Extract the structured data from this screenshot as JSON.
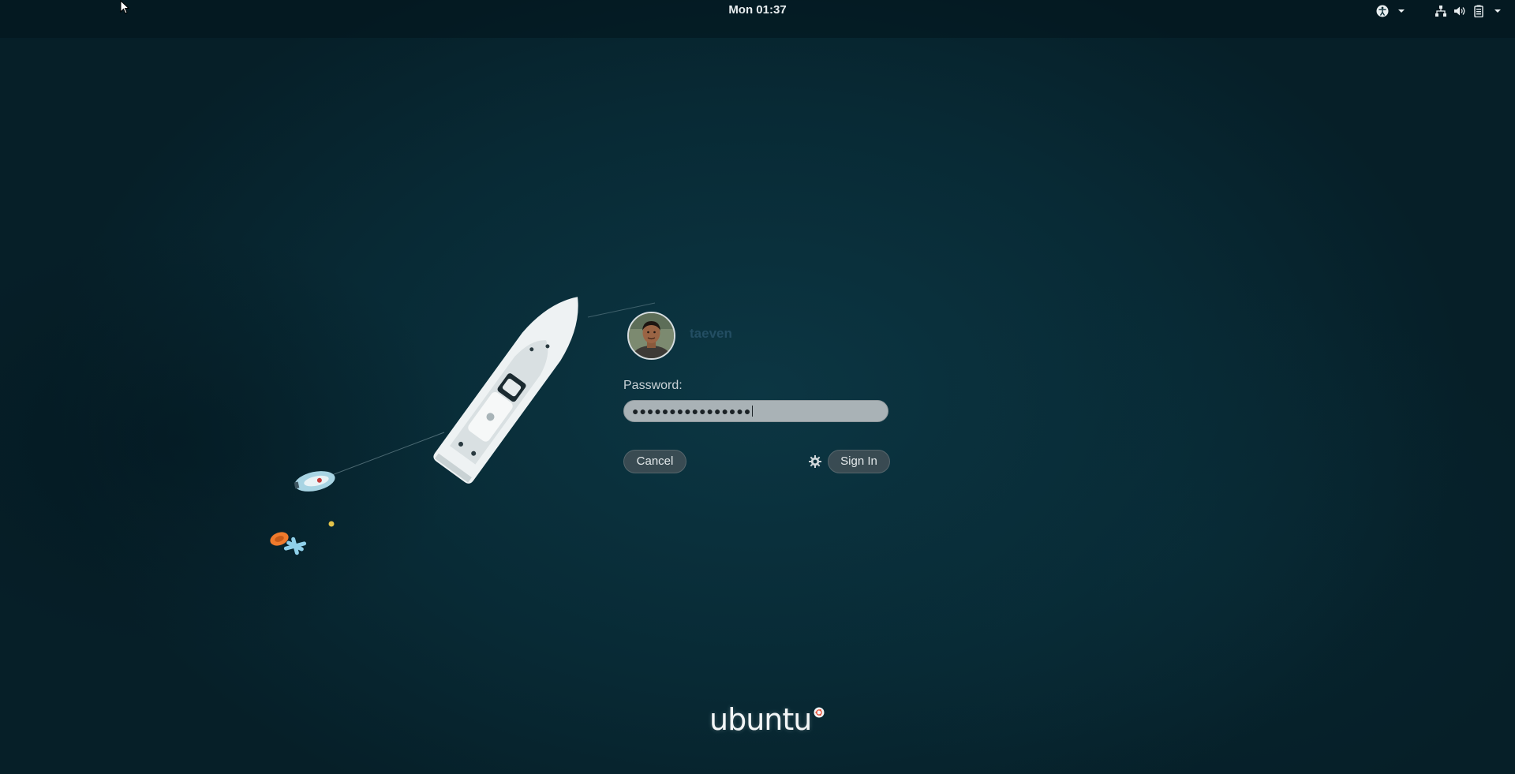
{
  "topbar": {
    "clock": "Mon 01:37",
    "tray_icons": [
      "accessibility-icon",
      "network-icon",
      "volume-icon",
      "battery-icon"
    ]
  },
  "login": {
    "username": "taeven",
    "password_label": "Password:",
    "password_value": "●●●●●●●●●●●●●●●●",
    "cancel_label": "Cancel",
    "signin_label": "Sign In"
  },
  "branding": {
    "logo_text": "ubuntu"
  },
  "colors": {
    "wallpaper": "#0a303c",
    "username": "#234e63",
    "input_bg": "#a9b2b6",
    "button_bg": "#465258"
  }
}
